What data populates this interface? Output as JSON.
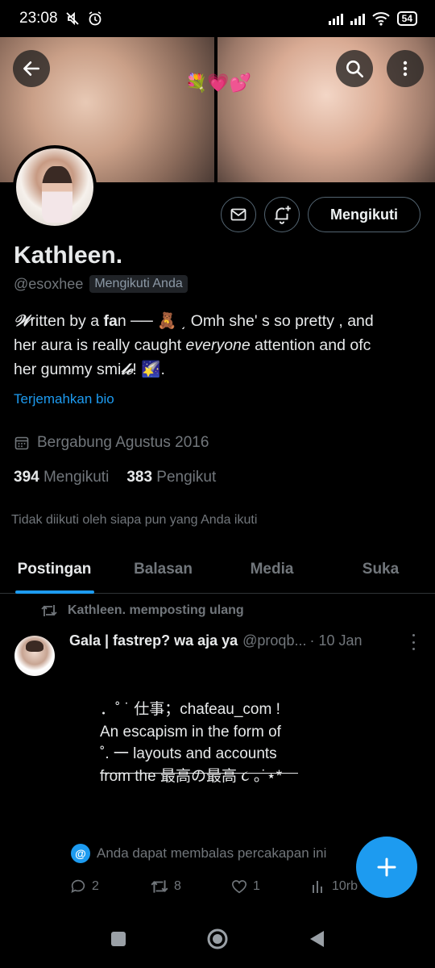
{
  "status_bar": {
    "time": "23:08",
    "battery": "54",
    "icons": [
      "mute-icon",
      "alarm-icon",
      "signal-icon",
      "signal-icon",
      "wifi-icon",
      "battery-icon"
    ]
  },
  "header": {
    "back_icon": "arrow-left-icon",
    "search_icon": "search-icon",
    "more_icon": "more-vertical-icon",
    "banner_emoji": "💐💗💕"
  },
  "profile": {
    "name": "Kathleen.",
    "handle": "@esoxhee",
    "follows_you": "Mengikuti Anda",
    "bio_prefix_fancy": "𝒲",
    "bio_line1_a": "ritten by a ",
    "bio_bold": "fa",
    "bio_line1_b": "n ── 🧸 ͵ Omh she' s so pretty , and",
    "bio_line2_a": "her aura is really caught ",
    "bio_italic": "everyone",
    "bio_line2_b": " attention and ofc",
    "bio_line3": "her gummy smi",
    "bio_line3_fancy": "𝓁ℯ",
    "bio_line3_end": "! 🌠.",
    "translate": "Terjemahkan bio",
    "joined": "Bergabung Agustus 2016",
    "following_count": "394",
    "following_label": "Mengikuti",
    "followers_count": "383",
    "followers_label": "Pengikut",
    "not_followed": "Tidak diikuti oleh siapa pun yang Anda ikuti"
  },
  "actions": {
    "message_icon": "envelope-icon",
    "notify_icon": "bell-plus-icon",
    "follow_label": "Mengikuti"
  },
  "tabs": [
    {
      "label": "Postingan",
      "active": true
    },
    {
      "label": "Balasan",
      "active": false
    },
    {
      "label": "Media",
      "active": false
    },
    {
      "label": "Suka",
      "active": false
    }
  ],
  "post": {
    "repost_text": "Kathleen. memposting ulang",
    "author_name": "Gala | fastrep? wa aja ya",
    "author_handle": "@proqb...",
    "date": "· 10 Jan",
    "lines": [
      "．˚ ˙ 仕事；chaƭeau_com !",
      "An escapism in the form of",
      "˚. 一 layouts and accounts",
      "from the 最高の最高 ૮ ｡˙⋆*"
    ],
    "reply_note": "Anda dapat membalas percakapan ini",
    "replies": "2",
    "reposts": "8",
    "likes": "1",
    "views": "10rb"
  },
  "accent": "#1d9bf0",
  "background": "#000000"
}
